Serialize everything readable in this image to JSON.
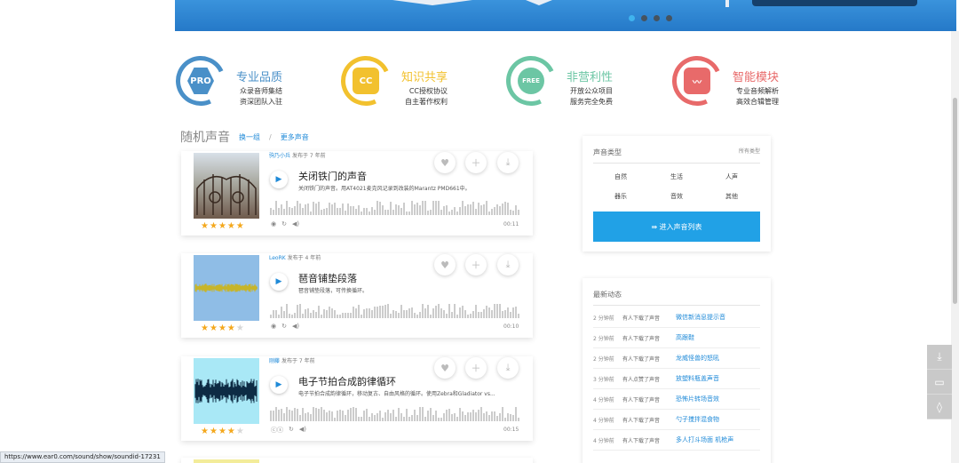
{
  "banner": {
    "dots": [
      true,
      false,
      false,
      false
    ]
  },
  "features": [
    {
      "badge": "PRO",
      "title": "专业品质",
      "lines": [
        "众录音师集结",
        "资深团队入驻"
      ],
      "color": "#4a90c8"
    },
    {
      "badge": "CC",
      "title": "知识共享",
      "lines": [
        "CC授权协议",
        "自主著作权利"
      ],
      "color": "#f2c12e"
    },
    {
      "badge": "FREE",
      "title": "非营利性",
      "lines": [
        "开放公众项目",
        "服务完全免费"
      ],
      "color": "#6cc6a4"
    },
    {
      "badge": "〰",
      "title": "智能模块",
      "lines": [
        "专业音频解析",
        "高效合辑管理"
      ],
      "color": "#e86a6a"
    }
  ],
  "section": {
    "title": "随机声音",
    "refresh": "换一组",
    "sep": "/",
    "more": "更多声音"
  },
  "sounds": [
    {
      "author": "驹乃小兵",
      "posted": "发布于 7 年前",
      "title": "关闭铁门的声音",
      "desc": "关闭铁门的声音。用AT4021麦克风记录到改装的Marantz PMD661中。",
      "duration": "00:11",
      "rating": 5,
      "thumb": "gate"
    },
    {
      "author": "LeoRK",
      "posted": "发布于 4 年前",
      "title": "琶音铺垫段落",
      "desc": "琶音铺垫段落，可传换循环。",
      "duration": "00:10",
      "rating": 4,
      "thumb": "wave-yellow"
    },
    {
      "author": "刚藤",
      "posted": "发布于 7 年前",
      "title": "电子节拍合成韵律循环",
      "desc": "电子节拍合成韵律循环，移动复古、自由风格的循环。使用Zebra和Gladiator vs...",
      "duration": "00:15",
      "rating": 4,
      "thumb": "wave-blue"
    }
  ],
  "sidebar": {
    "types_title": "声音类型",
    "types_all": "所有类型",
    "categories": [
      "自然",
      "生活",
      "人声",
      "器乐",
      "音效",
      "其他"
    ],
    "enter_label": "⇛ 进入声音列表",
    "feed_title": "最新动态",
    "feed": [
      {
        "time": "2 分钟前",
        "action": "有人下载了声音",
        "name": "微信新消息提示音"
      },
      {
        "time": "2 分钟前",
        "action": "有人下载了声音",
        "name": "高跟鞋"
      },
      {
        "time": "2 分钟前",
        "action": "有人下载了声音",
        "name": "龙威怪兽的怒吼"
      },
      {
        "time": "3 分钟前",
        "action": "有人点赞了声音",
        "name": "放塑料瓶盖声音"
      },
      {
        "time": "4 分钟前",
        "action": "有人下载了声音",
        "name": "恐怖片转场音效"
      },
      {
        "time": "4 分钟前",
        "action": "有人下载了声音",
        "name": "勺子搅拌混食物"
      },
      {
        "time": "4 分钟前",
        "action": "有人下载了声音",
        "name": "多人打斗场面 机枪声"
      }
    ]
  },
  "status_url": "https://www.ear0.com/sound/show/soundid-17231",
  "colors": {
    "accent": "#21a1e6",
    "link": "#1f8ad8",
    "star": "#f4a81d"
  }
}
